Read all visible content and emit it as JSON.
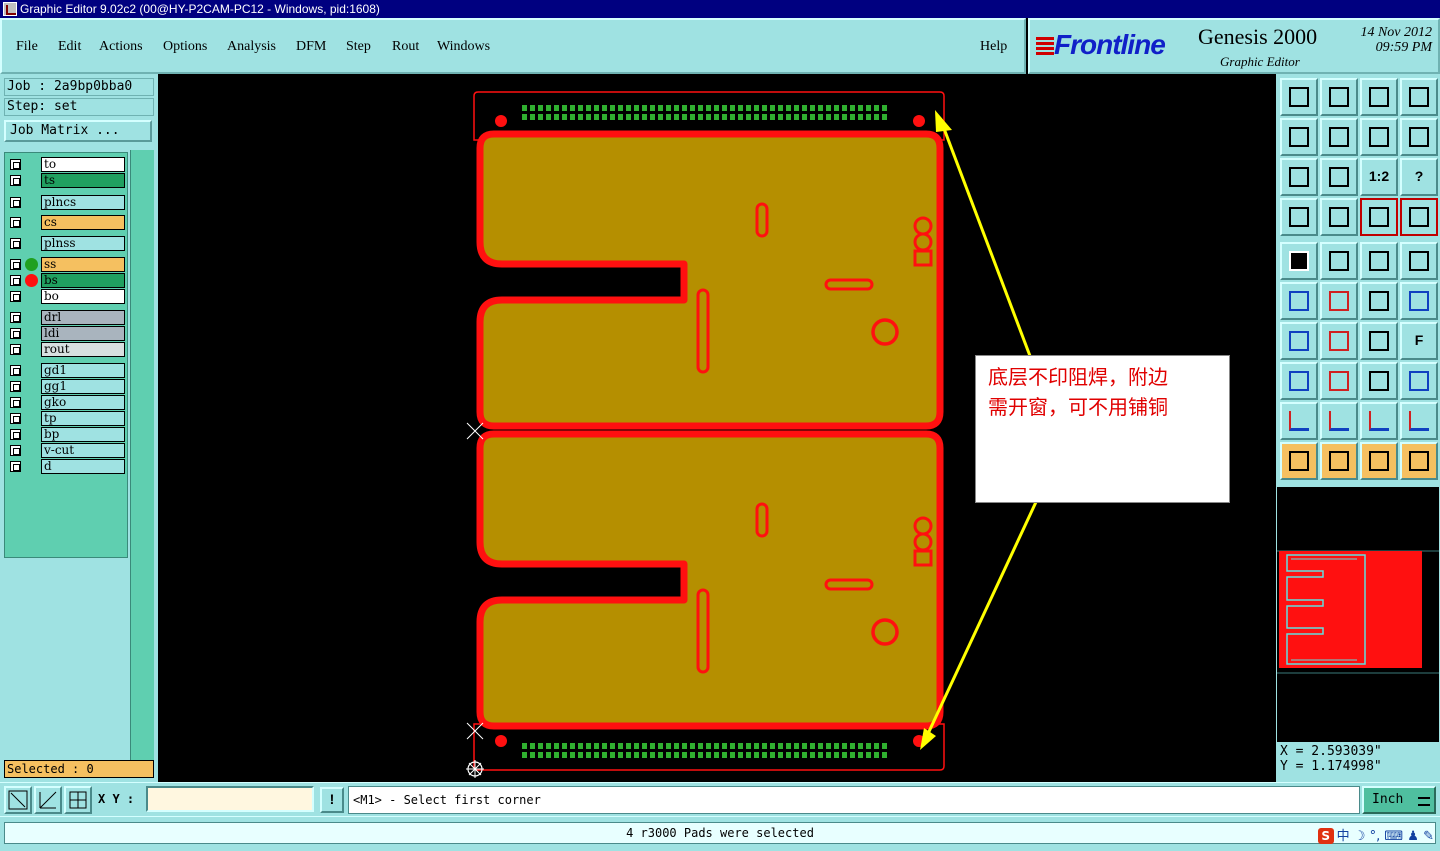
{
  "window": {
    "title": "Graphic Editor 9.02c2 (00@HY-P2CAM-PC12 - Windows, pid:1608)"
  },
  "menu": {
    "items": [
      "File",
      "Edit",
      "Actions",
      "Options",
      "Analysis",
      "DFM",
      "Step",
      "Rout",
      "Windows"
    ],
    "help": "Help"
  },
  "brand": {
    "logo": "Frontline",
    "product": "Genesis 2000",
    "subtitle": "Graphic Editor",
    "date": "14 Nov 2012",
    "time": "09:59 PM"
  },
  "job": {
    "job_line": "Job : 2a9bp0bba0",
    "step_line": "Step: set",
    "matrix_button": "Job Matrix ..."
  },
  "layers": [
    {
      "name": "to",
      "color": "#ffffff"
    },
    {
      "name": "ts",
      "color": "#20a060"
    },
    {
      "name": "plncs",
      "color": "#9fe2e2"
    },
    {
      "name": "cs",
      "color": "#f5c060"
    },
    {
      "name": "plnss",
      "color": "#9fe2e2"
    },
    {
      "name": "ss",
      "color": "#f5c060",
      "indicator": "#20a020"
    },
    {
      "name": "bs",
      "color": "#20a060",
      "indicator": "#ff1010"
    },
    {
      "name": "bo",
      "color": "#ffffff"
    },
    {
      "name": "drl",
      "color": "#a9b4be"
    },
    {
      "name": "ldi",
      "color": "#a9b4be"
    },
    {
      "name": "rout",
      "color": "#d8e0e0"
    },
    {
      "name": "gd1",
      "color": "#9fe2e2"
    },
    {
      "name": "gg1",
      "color": "#9fe2e2"
    },
    {
      "name": "gko",
      "color": "#9fe2e2"
    },
    {
      "name": "tp",
      "color": "#9fe2e2"
    },
    {
      "name": "bp",
      "color": "#9fe2e2"
    },
    {
      "name": "v-cut",
      "color": "#9fe2e2"
    },
    {
      "name": "d",
      "color": "#9fe2e2"
    }
  ],
  "selected_label": "Selected : 0",
  "callout": {
    "line1": "底层不印阻焊，附边",
    "line2": "需开窗，可不用铺铜"
  },
  "coords": {
    "x": "X  = 2.593039\"",
    "y": "Y  = 1.174998\""
  },
  "bottom": {
    "xy_label": "X Y :",
    "xy_value": "",
    "prompt": "<M1> - Select first corner",
    "unit": "Inch",
    "alert": "!"
  },
  "status": "4 r3000 Pads were selected",
  "tray": {
    "ime": "S",
    "lang": "中"
  },
  "colors": {
    "teal_bg": "#9fe2e2",
    "copper_fill": "#b58f00",
    "solder_red": "#ff1010",
    "pad_green": "#30b030",
    "annotation_yellow": "#ffff00"
  }
}
